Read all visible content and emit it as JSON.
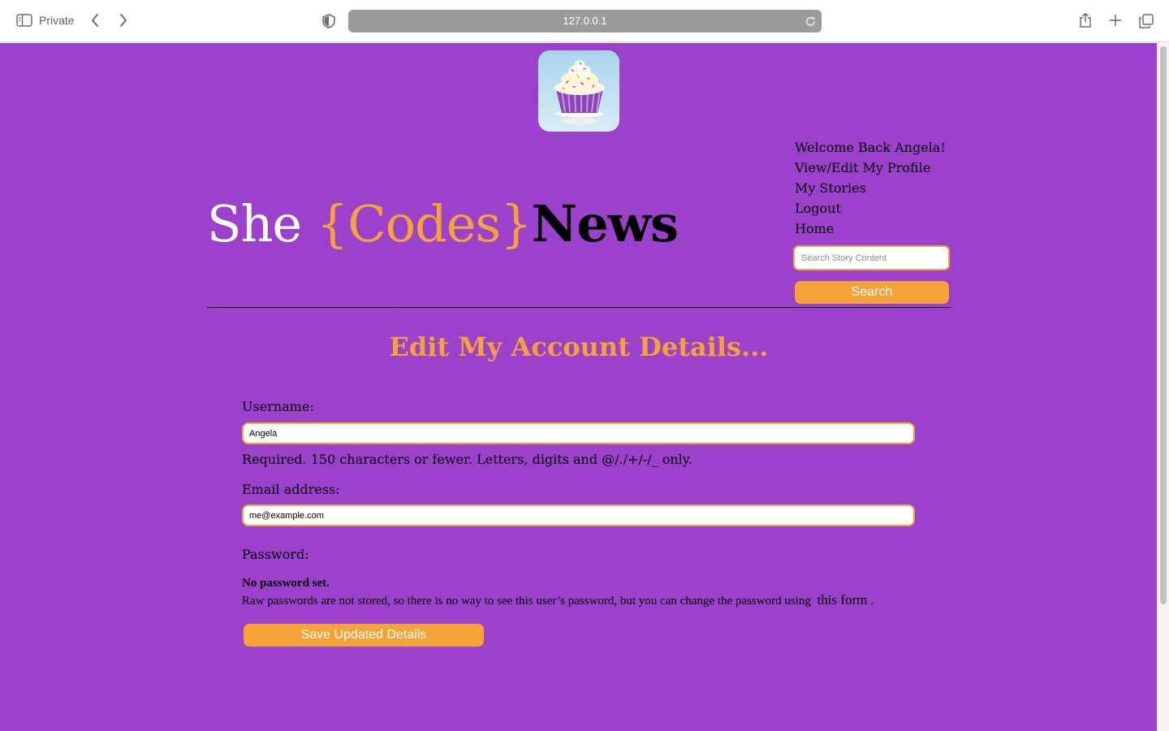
{
  "browser": {
    "private_label": "Private",
    "url": "127.0.0.1",
    "icons": [
      "sidebar-icon",
      "back-icon",
      "forward-icon",
      "shield-icon",
      "reload-icon",
      "share-icon",
      "new-tab-icon",
      "tabs-overview-icon"
    ]
  },
  "site": {
    "title_she": "She ",
    "title_codes": "{Codes}",
    "title_news": "News",
    "logo": "cupcake-logo"
  },
  "nav": {
    "welcome": "Welcome Back Angela!",
    "profile": "View/Edit My Profile",
    "stories": "My Stories",
    "logout": "Logout",
    "home": "Home"
  },
  "search": {
    "placeholder": "Search Story Content",
    "button": "Search"
  },
  "form": {
    "heading": "Edit My Account Details...",
    "username_label": "Username:",
    "username_value": "Angela",
    "username_help": "Required. 150 characters or fewer. Letters, digits and @/./+/-/_ only.",
    "email_label": "Email address:",
    "email_value": "me@example.com",
    "password_label": "Password:",
    "password_status": "No password set.",
    "password_help": "Raw passwords are not stored, so there is no way to see this user’s password, but you can change the password using",
    "password_link": "this form",
    "password_help_end": ".",
    "save_button": "Save Updated Details"
  },
  "colors": {
    "page_bg": "#9b41cc",
    "accent": "#f4a338",
    "title_white": "#ffffff",
    "text": "#000000"
  }
}
